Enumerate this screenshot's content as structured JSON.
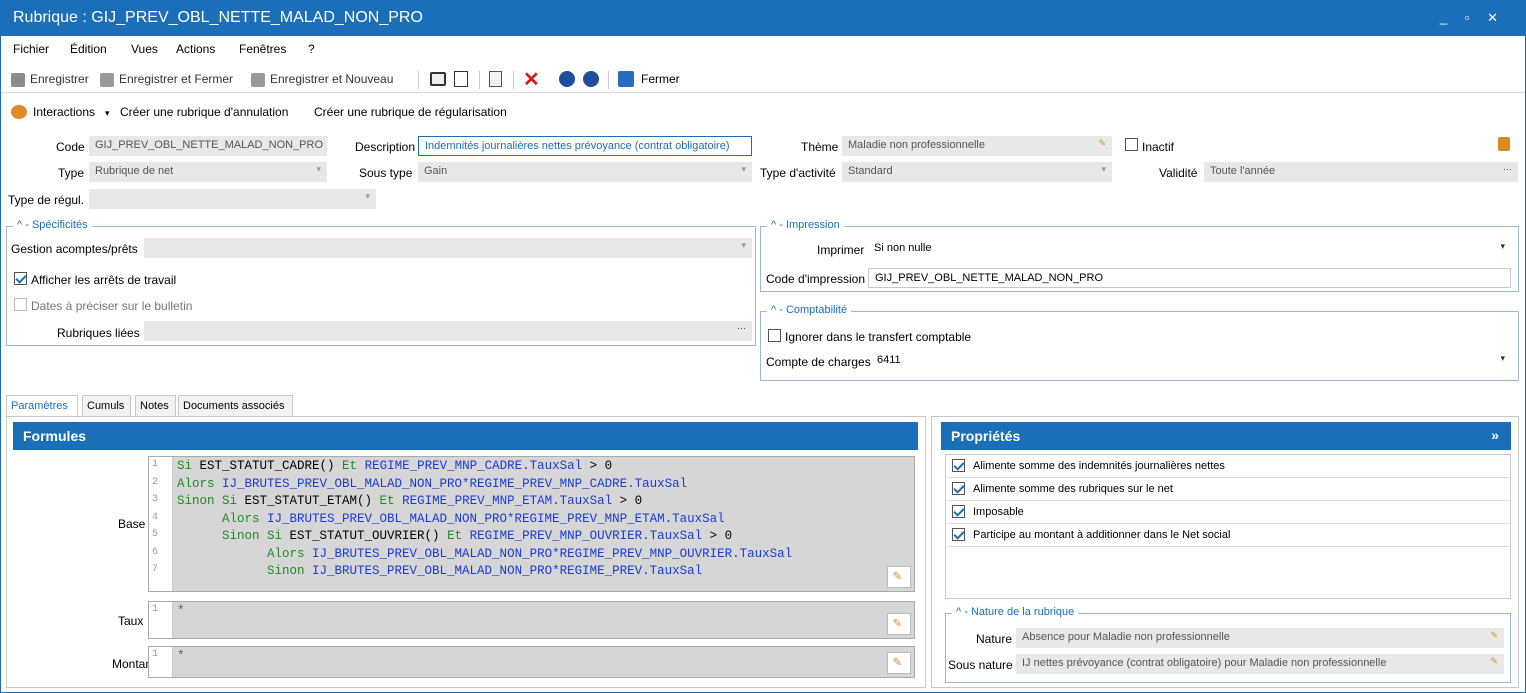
{
  "window": {
    "title": "Rubrique : GIJ_PREV_OBL_NETTE_MALAD_NON_PRO",
    "controls": "_ ▫ ✕"
  },
  "menu": [
    "Fichier",
    "Édition",
    "Vues",
    "Actions",
    "Fenêtres",
    "?"
  ],
  "toolbar": {
    "save": "Enregistrer",
    "save_close": "Enregistrer et Fermer",
    "save_new": "Enregistrer et Nouveau",
    "close": "Fermer"
  },
  "actions": {
    "interactions": "Interactions",
    "create_cancel": "Créer une rubrique d'annulation",
    "create_regul": "Créer une rubrique de régularisation"
  },
  "form": {
    "code_label": "Code",
    "code_value": "GIJ_PREV_OBL_NETTE_MALAD_NON_PRO",
    "description_label": "Description",
    "description_value": "Indemnités journalières nettes prévoyance (contrat obligatoire)",
    "theme_label": "Thème",
    "theme_value": "Maladie non professionnelle",
    "inactive_label": "Inactif",
    "type_label": "Type",
    "type_value": "Rubrique de net",
    "subtype_label": "Sous type",
    "subtype_value": "Gain",
    "activity_label": "Type d'activité",
    "activity_value": "Standard",
    "validity_label": "Validité",
    "validity_value": "Toute l'année",
    "regul_label": "Type de régul.",
    "regul_value": ""
  },
  "specificites": {
    "title": "Spécificités",
    "gestion_label": "Gestion acomptes/prêts",
    "gestion_value": "",
    "afficher_label": "Afficher les arrêts de travail",
    "afficher_checked": true,
    "dates_label": "Dates à préciser sur le bulletin",
    "dates_checked": false,
    "rubriques_label": "Rubriques liées",
    "rubriques_value": ""
  },
  "impression": {
    "title": "Impression",
    "imprimer_label": "Imprimer",
    "imprimer_value": "Si non nulle",
    "code_label": "Code d'impression",
    "code_value": "GIJ_PREV_OBL_NETTE_MALAD_NON_PRO"
  },
  "comptabilite": {
    "title": "Comptabilité",
    "ignorer_label": "Ignorer dans le transfert comptable",
    "ignorer_checked": false,
    "compte_label": "Compte de charges",
    "compte_value": "6411"
  },
  "tabs": [
    "Paramètres",
    "Cumuls",
    "Notes",
    "Documents associés"
  ],
  "formules": {
    "title": "Formules",
    "base_label": "Base",
    "taux_label": "Taux",
    "montant_label": "Montant",
    "base_lines": [
      {
        "n": "1",
        "parts": [
          [
            "kw",
            "Si "
          ],
          [
            "fn",
            "EST_STATUT_CADRE()"
          ],
          [
            "kw",
            " Et "
          ],
          [
            "vr",
            "REGIME_PREV_MNP_CADRE.TauxSal"
          ],
          [
            "fn",
            " > 0"
          ]
        ]
      },
      {
        "n": "2",
        "parts": [
          [
            "kw",
            "Alors "
          ],
          [
            "vr",
            "IJ_BRUTES_PREV_OBL_MALAD_NON_PRO*REGIME_PREV_MNP_CADRE.TauxSal"
          ]
        ]
      },
      {
        "n": "3",
        "parts": [
          [
            "kw",
            "Sinon Si "
          ],
          [
            "fn",
            "EST_STATUT_ETAM()"
          ],
          [
            "kw",
            " Et "
          ],
          [
            "vr",
            "REGIME_PREV_MNP_ETAM.TauxSal"
          ],
          [
            "fn",
            " > 0"
          ]
        ]
      },
      {
        "n": "4",
        "parts": [
          [
            "kw",
            "      Alors "
          ],
          [
            "vr",
            "IJ_BRUTES_PREV_OBL_MALAD_NON_PRO*REGIME_PREV_MNP_ETAM.TauxSal"
          ]
        ]
      },
      {
        "n": "5",
        "parts": [
          [
            "kw",
            "      Sinon Si "
          ],
          [
            "fn",
            "EST_STATUT_OUVRIER()"
          ],
          [
            "kw",
            " Et "
          ],
          [
            "vr",
            "REGIME_PREV_MNP_OUVRIER.TauxSal"
          ],
          [
            "fn",
            " > 0"
          ]
        ]
      },
      {
        "n": "6",
        "parts": [
          [
            "kw",
            "            Alors "
          ],
          [
            "vr",
            "IJ_BRUTES_PREV_OBL_MALAD_NON_PRO*REGIME_PREV_MNP_OUVRIER.TauxSal"
          ]
        ]
      },
      {
        "n": "7",
        "parts": [
          [
            "kw",
            "            Sinon "
          ],
          [
            "vr",
            "IJ_BRUTES_PREV_OBL_MALAD_NON_PRO*REGIME_PREV.TauxSal"
          ]
        ]
      }
    ],
    "taux_line": "*",
    "montant_line": "*",
    "gutter_one": "1"
  },
  "proprietes": {
    "title": "Propriétés",
    "expand": "»",
    "items": [
      "Alimente somme des indemnités journalières nettes",
      "Alimente somme des rubriques sur le net",
      "Imposable",
      "Participe au montant à additionner dans le Net social"
    ]
  },
  "nature": {
    "title": "Nature de la rubrique",
    "nature_label": "Nature",
    "nature_value": "Absence pour Maladie non professionnelle",
    "sous_nature_label": "Sous nature",
    "sous_nature_value": "IJ nettes prévoyance (contrat obligatoire) pour Maladie non professionnelle"
  },
  "colors": {
    "accent": "#1a6fb8"
  }
}
